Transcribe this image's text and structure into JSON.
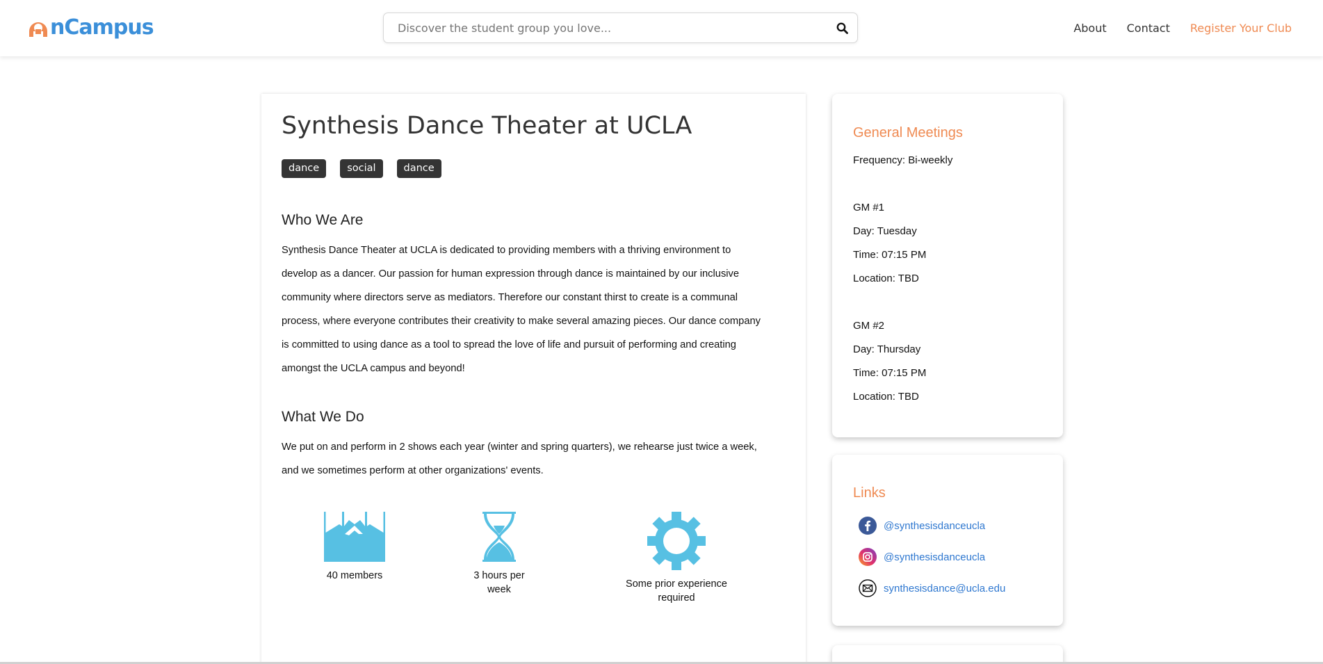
{
  "navbar": {
    "logo_text": "nCampus",
    "search": {
      "placeholder": "Discover the student group you love..."
    },
    "links": {
      "about": "About",
      "contact": "Contact",
      "register": "Register Your Club"
    }
  },
  "club": {
    "title": "Synthesis Dance Theater at UCLA",
    "tags": [
      "dance",
      "social",
      "dance"
    ],
    "who_title": "Who We Are",
    "who_text": "Synthesis Dance Theater at UCLA is dedicated to providing members with a thriving environment to develop as a dancer. Our passion for human expression through dance is maintained by our inclusive community where directors serve as mediators. Therefore our constant thirst to create is a communal process, where everyone contributes their creativity to make several amazing pieces. Our dance company is committed to using dance as a tool to spread the love of life and pursuit of performing and creating amongst the UCLA campus and beyond!",
    "what_title": "What We Do",
    "what_text": "We put on and perform in 2 shows each year (winter and spring quarters), we rehearse just twice a week, and we sometimes perform at other organizations' events.",
    "stats": {
      "members": "40 members",
      "hours": "3 hours per week",
      "experience": "Some prior experience required"
    }
  },
  "meetings": {
    "title": "General Meetings",
    "frequency": "Frequency: Bi-weekly",
    "gm1": {
      "label": "GM #1",
      "day": "Day: Tuesday",
      "time": "Time: 07:15 PM",
      "location": "Location: TBD"
    },
    "gm2": {
      "label": "GM #2",
      "day": "Day: Thursday",
      "time": "Time: 07:15 PM",
      "location": "Location: TBD"
    }
  },
  "links": {
    "title": "Links",
    "facebook": "@synthesisdanceucla",
    "instagram": "@synthesisdanceucla",
    "email": "synthesisdance@ucla.edu"
  },
  "colors": {
    "accent": "#ef8a52",
    "logo_blue": "#3b8fd9",
    "icon_blue": "#57c0e3",
    "link_blue": "#2f78d0",
    "tag_bg": "#343434"
  },
  "icons": {
    "search": "search-icon",
    "members": "mountains-icon",
    "hours": "hourglass-icon",
    "experience": "gear-icon",
    "facebook": "facebook-icon",
    "instagram": "instagram-icon",
    "email": "envelope-icon"
  }
}
